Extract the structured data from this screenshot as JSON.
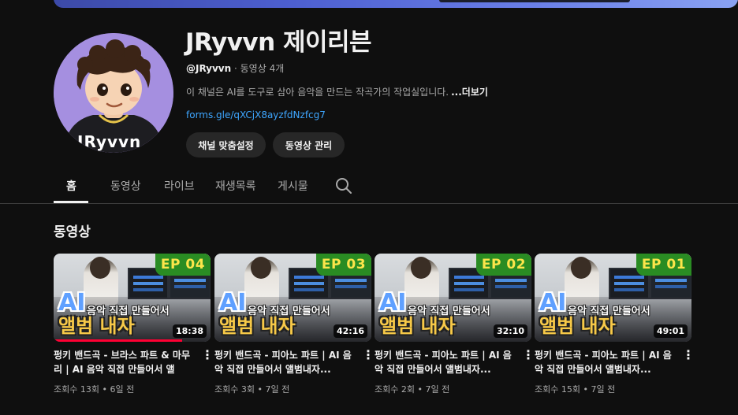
{
  "colors": {
    "background": "#0f0f0f",
    "link": "#3ea6ff",
    "pill": "#272727",
    "badge": "#2a8c23",
    "progress": "#ff0033"
  },
  "channel": {
    "avatar_text": "JRyvvn",
    "name": "JRyvvn 제이리븐",
    "handle": "@JRyvvn",
    "separator": " · ",
    "video_count": "동영상 4개",
    "description": "이 채널은 AI를 도구로 삼아 음악을 만드는 작곡가의 작업실입니다.",
    "more": "...더보기",
    "link": "forms.gle/qXCjX8ayzfdNzfcg7",
    "buttons": {
      "customize": "채널 맞춤설정",
      "manage": "동영상 관리"
    }
  },
  "tabs": [
    "홈",
    "동영상",
    "라이브",
    "재생목록",
    "게시물"
  ],
  "section_title": "동영상",
  "videos": [
    {
      "ep": "EP 04",
      "ai": "AI",
      "subtitle": "음악 직접 만들어서",
      "album": "앨범 내자",
      "duration": "18:38",
      "progress": 0.82,
      "title": "펑키 밴드곡 - 브라스 파트 & 마무리 | AI 음악 직접 만들어서 앨범...",
      "meta": "조회수 13회 • 6일 전"
    },
    {
      "ep": "EP 03",
      "ai": "AI",
      "subtitle": "음악 직접 만들어서",
      "album": "앨범 내자",
      "duration": "42:16",
      "progress": 0.0,
      "title": "펑키 밴드곡 - 피아노 파트 | AI 음악 직접 만들어서 앨범내자...",
      "meta": "조회수 3회 • 7일 전"
    },
    {
      "ep": "EP 02",
      "ai": "AI",
      "subtitle": "음악 직접 만들어서",
      "album": "앨범 내자",
      "duration": "32:10",
      "progress": 0.0,
      "title": "펑키 밴드곡 - 피아노 파트 | AI 음악 직접 만들어서 앨범내자...",
      "meta": "조회수 2회 • 7일 전"
    },
    {
      "ep": "EP 01",
      "ai": "AI",
      "subtitle": "음악 직접 만들어서",
      "album": "앨범 내자",
      "duration": "49:01",
      "progress": 0.0,
      "title": "펑키 밴드곡 - 피아노 파트 | AI 음악 직접 만들어서 앨범내자...",
      "meta": "조회수 15회 • 7일 전"
    }
  ],
  "icons": {
    "search": "search-icon",
    "menu": "more-vert-icon"
  }
}
